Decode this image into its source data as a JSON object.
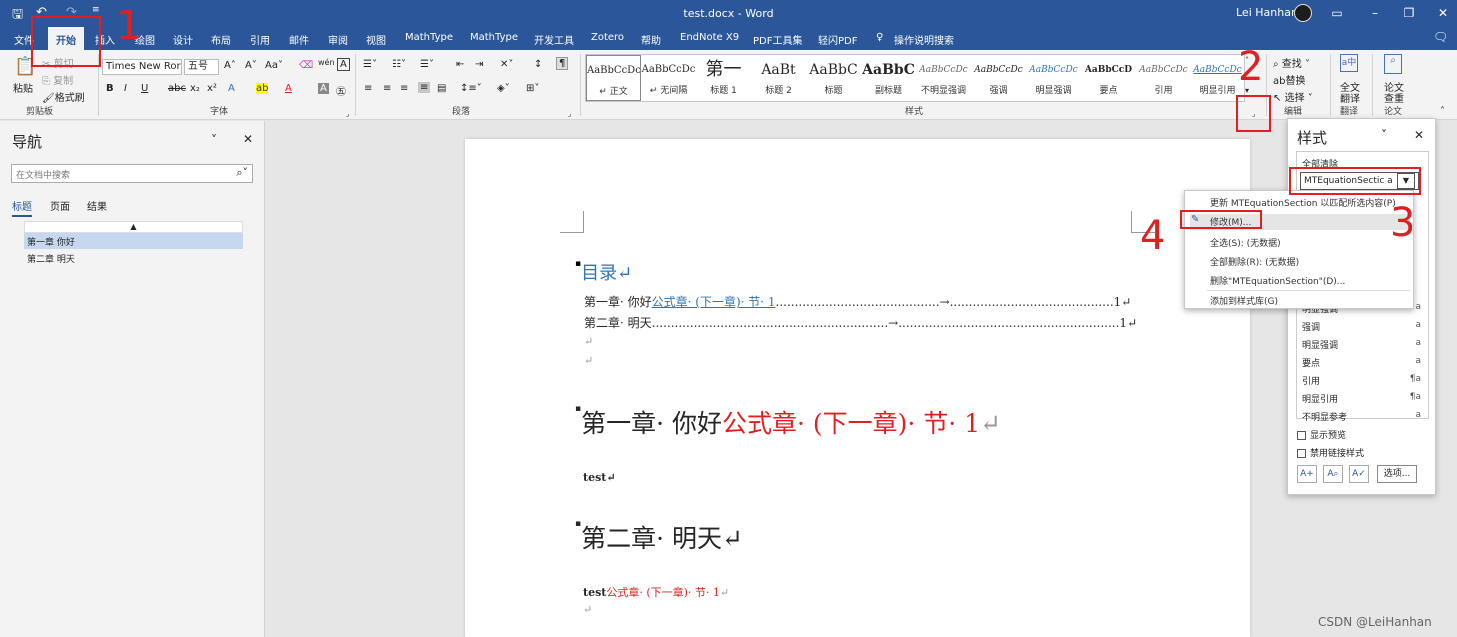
{
  "window": {
    "title": "test.docx  -  Word",
    "user": "Lei Hanhan"
  },
  "tabs": [
    "文件",
    "开始",
    "插入",
    "绘图",
    "设计",
    "布局",
    "引用",
    "邮件",
    "审阅",
    "视图",
    "MathType",
    "MathType",
    "开发工具",
    "Zotero",
    "帮助",
    "EndNote X9",
    "PDF工具集",
    "轻闪PDF"
  ],
  "tell_me": "操作说明搜索",
  "ribbon": {
    "clipboard": {
      "paste": "粘贴",
      "cut": "剪切",
      "copy": "复制",
      "format_painter": "格式刷",
      "label": "剪贴板"
    },
    "font": {
      "name": "Times New Ror",
      "size": "五号",
      "label": "字体"
    },
    "paragraph": {
      "label": "段落"
    },
    "styles": {
      "label": "样式",
      "items": [
        {
          "preview": "AaBbCcDc",
          "name": "↵ 正文"
        },
        {
          "preview": "AaBbCcDc",
          "name": "↵ 无间隔"
        },
        {
          "preview": "第一",
          "name": "标题 1"
        },
        {
          "preview": "AaBt",
          "name": "标题 2"
        },
        {
          "preview": "AaBbC",
          "name": "标题"
        },
        {
          "preview": "AaBbC",
          "name": "副标题"
        },
        {
          "preview": "AaBbCcDc",
          "name": "不明显强调"
        },
        {
          "preview": "AaBbCcDc",
          "name": "强调"
        },
        {
          "preview": "AaBbCcDc",
          "name": "明显强调"
        },
        {
          "preview": "AaBbCcD",
          "name": "要点"
        },
        {
          "preview": "AaBbCcDc",
          "name": "引用"
        },
        {
          "preview": "AaBbCcDc",
          "name": "明显引用"
        }
      ]
    },
    "editing": {
      "find": "查找",
      "replace": "替换",
      "select": "选择",
      "label": "编辑"
    },
    "translate": {
      "label1": "全文",
      "label2": "翻译",
      "group": "翻译"
    },
    "paper": {
      "label1": "论文",
      "label2": "查重",
      "group": "论文"
    }
  },
  "nav": {
    "title": "导航",
    "search_placeholder": "在文档中搜索",
    "tabs": [
      "标题",
      "页面",
      "结果"
    ],
    "headings": [
      "第一章  你好",
      "第二章  明天"
    ]
  },
  "document": {
    "toc_title": "目录↵",
    "toc1_prefix": "第一章· 你好",
    "toc1_link": "公式章· (下一章)· 节· 1",
    "toc1_dots": "...........................................→...........................................1↵",
    "toc2_prefix": "第二章· 明天",
    "toc2_dots": "..............................................................→..........................................................1↵",
    "para_mark": "↵",
    "h1_black": "第一章· 你好",
    "h1_red": "公式章· (下一章)· 节· 1",
    "h1_end": "↵",
    "body1": "test↵",
    "h2": "第二章· 明天↵",
    "body2_black": "test",
    "body2_red": "公式章· (下一章)· 节· 1",
    "body2_end": "↵"
  },
  "style_pane": {
    "title": "样式",
    "clear_all": "全部清除",
    "selected": "MTEquationSectic",
    "list": [
      {
        "name": "明显强调",
        "mark": "a"
      },
      {
        "name": "强调",
        "mark": "a"
      },
      {
        "name": "明显强调",
        "mark": "a"
      },
      {
        "name": "要点",
        "mark": "a"
      },
      {
        "name": "引用",
        "mark": "¶a"
      },
      {
        "name": "明显引用",
        "mark": "¶a"
      },
      {
        "name": "不明显参考",
        "mark": "a"
      }
    ],
    "show_preview": "显示预览",
    "disable_linked": "禁用链接样式",
    "options": "选项..."
  },
  "context_menu": [
    "更新 MTEquationSection 以匹配所选内容(P)",
    "修改(M)...",
    "全选(S): (无数据)",
    "全部删除(R): (无数据)",
    "删除\"MTEquationSection\"(D)...",
    "添加到样式库(G)"
  ],
  "annotations": [
    "1",
    "2",
    "3",
    "4"
  ],
  "watermark": "CSDN @LeiHanhan",
  "colors": {
    "word_blue": "#2b579a",
    "red": "#e02020",
    "link": "#2e74b5"
  }
}
